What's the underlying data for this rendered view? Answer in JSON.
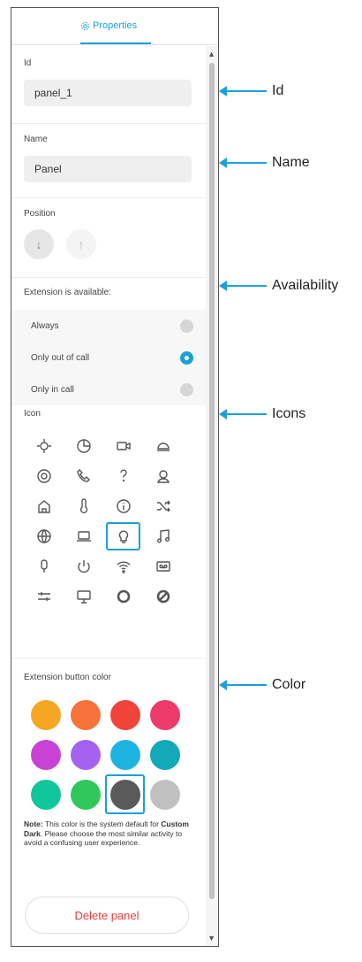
{
  "tab": {
    "label": "Properties",
    "icon": "gear-icon"
  },
  "id_section": {
    "label": "Id",
    "value": "panel_1"
  },
  "name_section": {
    "label": "Name",
    "value": "Panel"
  },
  "position_section": {
    "label": "Position",
    "down_icon": "arrow-down-icon",
    "up_icon": "arrow-up-icon"
  },
  "availability": {
    "label": "Extension is available:",
    "options": [
      {
        "label": "Always",
        "selected": false
      },
      {
        "label": "Only out of call",
        "selected": true
      },
      {
        "label": "Only in call",
        "selected": false
      }
    ]
  },
  "icons": {
    "label": "Icon",
    "items": [
      "brightness-icon",
      "pie-chart-icon",
      "video-camera-icon",
      "meeting-light-icon",
      "target-icon",
      "phone-icon",
      "question-icon",
      "helpdesk-icon",
      "home-icon",
      "thermometer-icon",
      "info-icon",
      "shuffle-icon",
      "globe-icon",
      "laptop-icon",
      "lightbulb-icon",
      "music-icon",
      "microphone-icon",
      "power-icon",
      "wifi-icon",
      "voicemail-icon",
      "sliders-icon",
      "monitor-icon",
      "blinds-icon",
      "disc-icon"
    ],
    "selected_index": 14
  },
  "color_section": {
    "label": "Extension button color",
    "swatches": [
      "#f5a623",
      "#f5733a",
      "#f0443b",
      "#ec3a6a",
      "#c942d6",
      "#a562f0",
      "#1eb4e2",
      "#12a9b9",
      "#0fc79a",
      "#2fc85a",
      "#5a5a5a",
      "#c0c0c0"
    ],
    "selected_index": 10,
    "note_bold": "Note:",
    "note_text_1": " This color is the system default for ",
    "note_theme": "Custom Dark",
    "note_text_2": ". Please choose the most similar activity to avoid a confusing user experience."
  },
  "delete_button": {
    "label": "Delete panel"
  },
  "callouts": [
    {
      "label": "Id"
    },
    {
      "label": "Name"
    },
    {
      "label": "Availability"
    },
    {
      "label": "Icons"
    },
    {
      "label": "Color"
    }
  ]
}
